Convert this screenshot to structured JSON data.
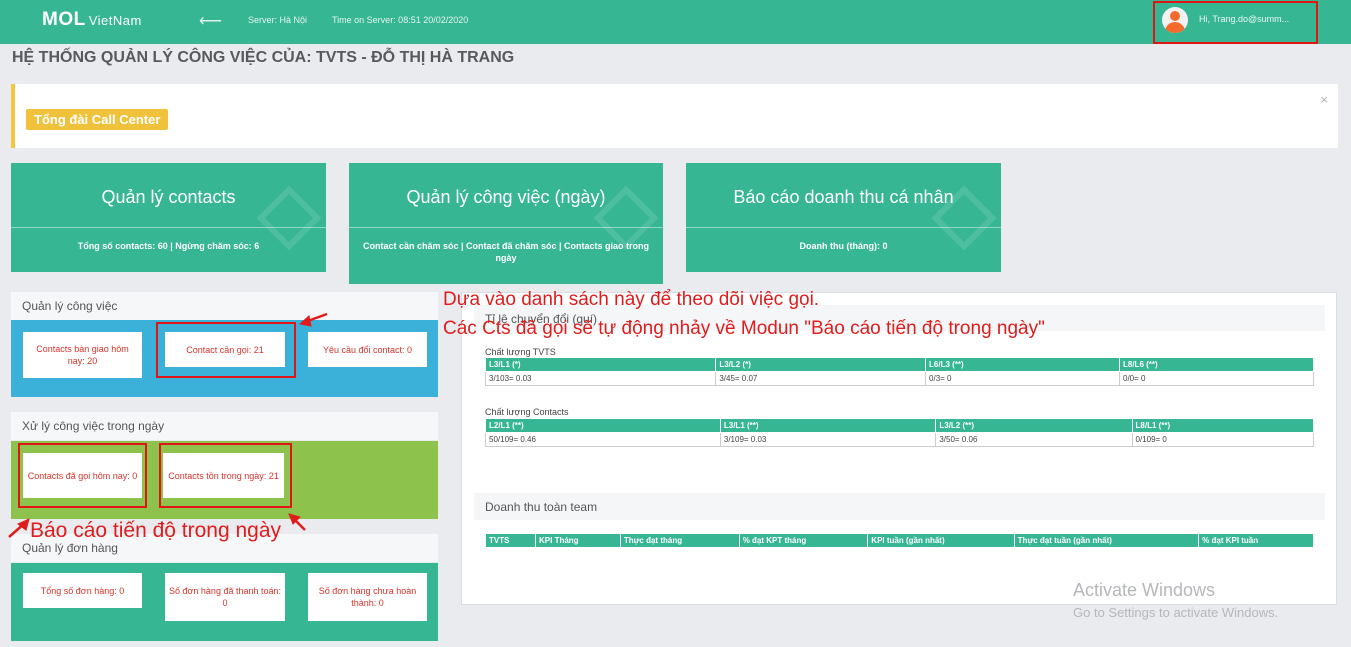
{
  "topbar": {
    "logo": "MOL",
    "logo_sub": "VietNam",
    "back_icon": "arrow-left",
    "server": "Server: Hà Nội",
    "time": "Time on Server: 08:51 20/02/2020",
    "user_greeting": "Hi, Trang.do@summ..."
  },
  "page_title": "HỆ THỐNG QUẢN LÝ CÔNG VIỆC CỦA: TVTS - ĐỖ THỊ HÀ TRANG",
  "callcenter": {
    "button": "Tổng đài Call Center",
    "close": "×"
  },
  "cards": [
    {
      "title": "Quản lý contacts",
      "stats": "Tổng số contacts: 60  |  Ngừng chăm sóc: 6"
    },
    {
      "title": "Quản lý công việc (ngày)",
      "stats": "Contact cần chăm sóc  |  Contact đã chăm sóc  |  Contacts giao trong ngày"
    },
    {
      "title": "Báo cáo doanh thu cá nhân",
      "stats": "Doanh thu (tháng): 0"
    }
  ],
  "work": {
    "title": "Quản lý công việc",
    "items": [
      "Contacts bàn giao hôm nay: 20",
      "Contact cần gọi: 21",
      "Yêu cầu đổi contact: 0"
    ]
  },
  "daily": {
    "title": "Xử lý công việc trong ngày",
    "items": [
      "Contacts đã gọi hôm nay: 0",
      "Contacts tồn trong ngày: 21"
    ]
  },
  "orders": {
    "title": "Quản lý đơn hàng",
    "items": [
      "Tổng số đơn hàng: 0",
      "Số đơn hàng đã thanh toán: 0",
      "Số đơn hàng chưa hoàn thành: 0"
    ]
  },
  "conversion": {
    "title": "Tỉ lệ chuyển đổi (quí)",
    "tvts_label": "Chất lượng TVTS",
    "tvts_headers": [
      "L3/L1 (*)",
      "L3/L2 (*)",
      "L6/L3 (**)",
      "L8/L6 (**)"
    ],
    "tvts_values": [
      "3/103= 0.03",
      "3/45= 0.07",
      "0/3= 0",
      "0/0= 0"
    ],
    "contacts_label": "Chất lượng Contacts",
    "contacts_headers": [
      "L2/L1 (**)",
      "L3/L1 (**)",
      "L3/L2 (**)",
      "L8/L1 (**)"
    ],
    "contacts_values": [
      "50/109= 0.46",
      "3/109= 0.03",
      "3/50= 0.06",
      "0/109= 0"
    ]
  },
  "team_revenue": {
    "title": "Doanh thu toàn team",
    "headers": [
      "TVTS",
      "KPI Tháng",
      "Thực đạt tháng",
      "% đạt KPT tháng",
      "KPI tuần (gần nhất)",
      "Thực đạt tuần (gần nhất)",
      "% đạt KPI tuần"
    ]
  },
  "annotations": {
    "line1": "Dựa vào danh sách này để theo dõi việc gọi.",
    "line2": "Các Cts đã gọi sẽ tự động nhảy về Modun \"Báo cáo tiến độ trong ngày\"",
    "line3": "Báo cáo tiến độ trong ngày",
    "color": "#e01c1c"
  },
  "watermark": {
    "title": "Activate Windows",
    "subtitle": "Go to Settings to activate Windows."
  },
  "colors": {
    "primary": "#36b693",
    "blue": "#3bb0d9",
    "lime": "#8dc34d",
    "highlight": "#e01515",
    "accent": "#f0c23b"
  }
}
